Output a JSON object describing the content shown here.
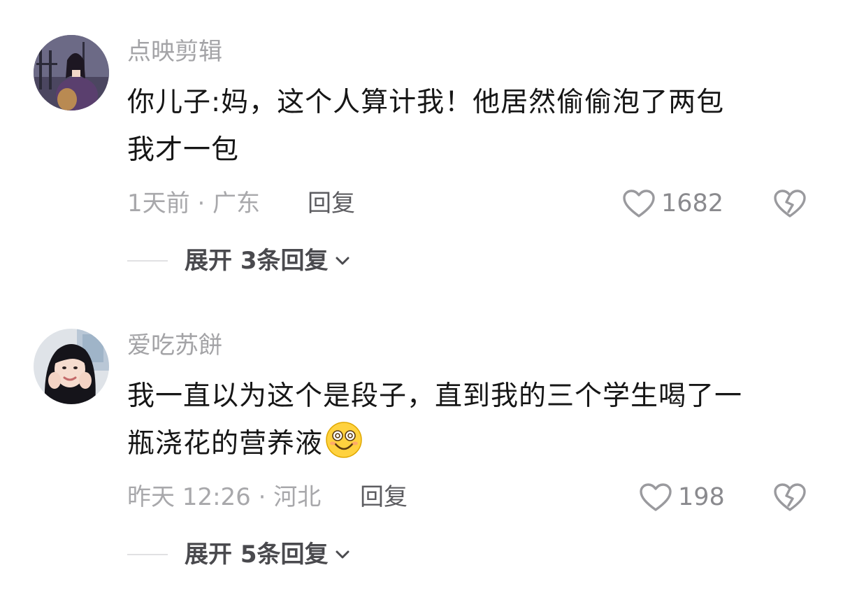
{
  "comments": [
    {
      "username": "点映剪辑",
      "text_lines": [
        "你儿子:妈，这个人算计我！他居然偷偷泡了两包",
        "我才一包"
      ],
      "time_location": "1天前 · 广东",
      "reply_label": "回复",
      "like_count": "1682",
      "expand_label": "展开 3条回复",
      "avatar_icon": "avatar-ancient-costume-woman",
      "trailing_emoji": null
    },
    {
      "username": "爱吃苏餅",
      "text_lines": [
        "我一直以为这个是段子，直到我的三个学生喝了一",
        "瓶浇花的营养液"
      ],
      "time_location": "昨天 12:26 · 河北",
      "reply_label": "回复",
      "like_count": "198",
      "expand_label": "展开 5条回复",
      "avatar_icon": "avatar-smiling-girl",
      "trailing_emoji": "dizzy-smile-emoji"
    }
  ],
  "icons": {
    "like": "heart-outline-icon",
    "dislike": "broken-heart-icon",
    "expand": "chevron-down-icon"
  },
  "colors": {
    "username": "#a3a3a6",
    "content": "#161616",
    "meta": "#a8a8ab",
    "reply": "#5c5c60",
    "icon_gray": "#9a9a9e"
  }
}
